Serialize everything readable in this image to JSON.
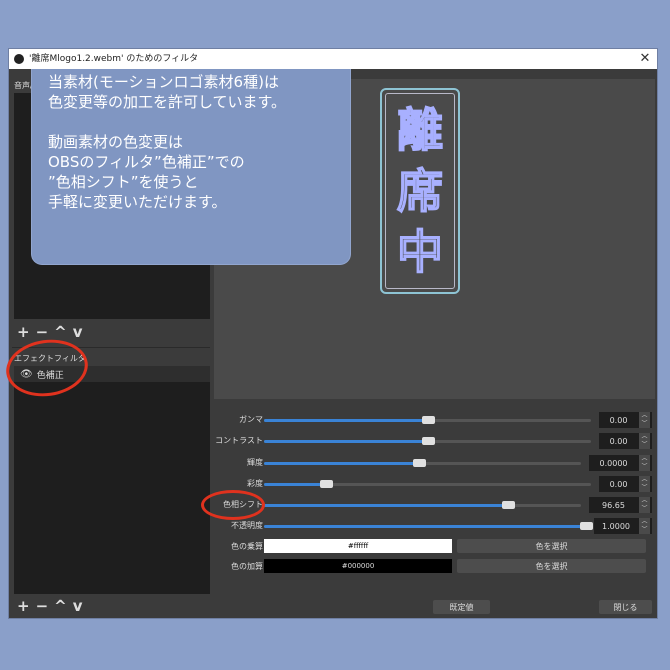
{
  "window": {
    "title": "'離席Mlogo1.2.webm' のためのフィルタ",
    "close": "✕"
  },
  "left": {
    "av_filters_label": "音声/映像フィルタ",
    "effect_filters_label": "エフェクトフィルタ",
    "effect_items": [
      {
        "label": "色補正",
        "icon": "eye-icon"
      }
    ],
    "toolbar": [
      "+",
      "−",
      "^",
      "v"
    ]
  },
  "callout": {
    "lines": [
      "当素材(モーションロゴ素材6種)は",
      "色変更等の加工を許可しています。"
    ],
    "lines2": [
      "動画素材の色変更は",
      "OBSのフィルタ”色補正”での",
      "”色相シフト”を使うと",
      "手軽に変更いただけます。"
    ]
  },
  "logo": {
    "chars": [
      "離",
      "席",
      "中"
    ]
  },
  "sliders": [
    {
      "label": "ガンマ",
      "value": "0.00",
      "fraction": 0.5
    },
    {
      "label": "コントラスト",
      "value": "0.00",
      "fraction": 0.5
    },
    {
      "label": "輝度",
      "value": "0.0000",
      "fraction": 0.49
    },
    {
      "label": "彩度",
      "value": "0.00",
      "fraction": 0.19
    },
    {
      "label": "色相シフト",
      "value": "96.65",
      "fraction": 0.77
    },
    {
      "label": "不透明度",
      "value": "1.0000",
      "fraction": 1.0
    }
  ],
  "colors": [
    {
      "label": "色の乗算",
      "value": "#ffffff",
      "button": "色を選択"
    },
    {
      "label": "色の加算",
      "value": "#000000",
      "button": "色を選択"
    }
  ],
  "buttons": {
    "defaults": "既定値",
    "close": "閉じる"
  },
  "accent": "#3a83d6",
  "annotation_color": "#e0321e"
}
